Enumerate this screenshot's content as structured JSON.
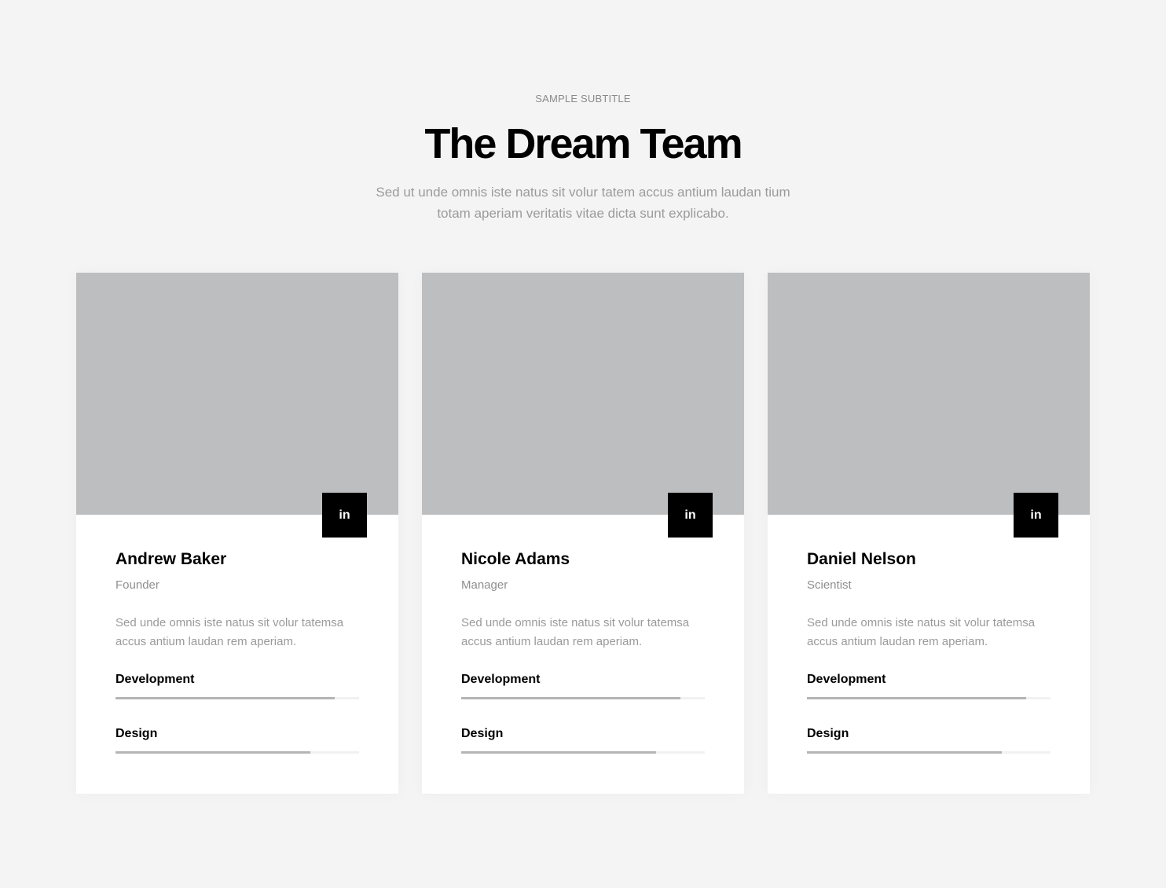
{
  "header": {
    "subtitle": "SAMPLE SUBTITLE",
    "title": "The Dream Team",
    "lead": "Sed ut unde omnis iste natus sit volur tatem accus antium laudan tium totam aperiam veritatis vitae dicta sunt explicabo."
  },
  "members": [
    {
      "name": "Andrew Baker",
      "role": "Founder",
      "bio": "Sed unde omnis iste natus sit volur tatemsa accus antium laudan rem aperiam.",
      "social_label": "in",
      "skills": [
        {
          "label": "Development",
          "level": 0.9
        },
        {
          "label": "Design",
          "level": 0.8
        }
      ]
    },
    {
      "name": "Nicole Adams",
      "role": "Manager",
      "bio": "Sed unde omnis iste natus sit volur tatemsa accus antium laudan rem aperiam.",
      "social_label": "in",
      "skills": [
        {
          "label": "Development",
          "level": 0.9
        },
        {
          "label": "Design",
          "level": 0.8
        }
      ]
    },
    {
      "name": "Daniel Nelson",
      "role": "Scientist",
      "bio": "Sed unde omnis iste natus sit volur tatemsa accus antium laudan rem aperiam.",
      "social_label": "in",
      "skills": [
        {
          "label": "Development",
          "level": 0.9
        },
        {
          "label": "Design",
          "level": 0.8
        }
      ]
    }
  ],
  "icons": {
    "social": "linkedin-icon"
  },
  "colors": {
    "background": "#f4f4f4",
    "card": "#ffffff",
    "photo_placeholder": "#bdbebf",
    "social_button": "#000000",
    "skill_fill": "#b5b5b5",
    "skill_track": "#f1f1f1"
  }
}
